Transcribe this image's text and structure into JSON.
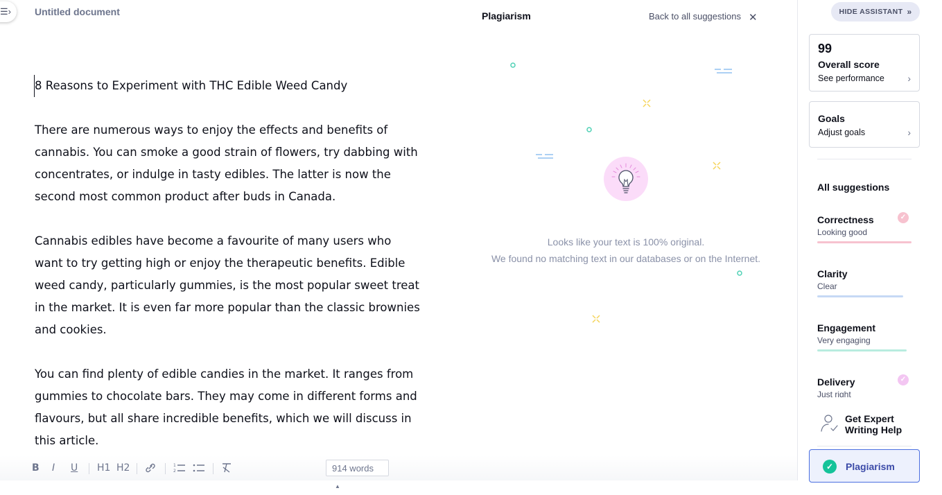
{
  "document": {
    "title": "Untitled document",
    "heading": "8 Reasons to Experiment with THC Edible Weed Candy",
    "paragraphs": [
      "There are numerous ways to enjoy the effects and benefits of cannabis. You can smoke a good strain of flowers, try dabbing with concentrates, or indulge in tasty edibles. The latter is now the second most common product after buds in Canada.",
      "Cannabis edibles have become a favourite of many users who want to try getting high or enjoy the therapeutic benefits. Edible weed candy, particularly gummies, is the most popular sweet treat in the market. It is even far more popular than the classic brownies and cookies.",
      "You can find plenty of edible candies in the market. It ranges from gummies to chocolate bars. They may come in different forms and flavours, but all share incredible benefits, which we will discuss in this article."
    ]
  },
  "toolbar": {
    "bold": "B",
    "italic": "I",
    "underline": "U",
    "h1": "H1",
    "h2": "H2",
    "word_count": "914 words"
  },
  "plagiarism_panel": {
    "title": "Plagiarism",
    "back_link": "Back to all suggestions",
    "message_line1": "Looks like your text is 100% original.",
    "message_line2": "We found no matching text in our databases or on the Internet."
  },
  "assistant": {
    "hide_button": "HIDE ASSISTANT",
    "score": {
      "value": "99",
      "label": "Overall score",
      "link": "See performance"
    },
    "goals": {
      "label": "Goals",
      "link": "Adjust goals"
    },
    "all_suggestions": "All suggestions",
    "categories": [
      {
        "name": "Correctness",
        "status": "Looking good",
        "color": "#f7c2cf"
      },
      {
        "name": "Clarity",
        "status": "Clear",
        "color": "#c6d9f5"
      },
      {
        "name": "Engagement",
        "status": "Very engaging",
        "color": "#b8ecdf"
      },
      {
        "name": "Delivery",
        "status": "Just right",
        "color": "#f3c6f2"
      }
    ],
    "expert_help": "Get Expert Writing Help",
    "plagiarism_button": "Plagiarism"
  },
  "colors": {
    "accent": "#4a6ee0",
    "success": "#15c39a"
  }
}
